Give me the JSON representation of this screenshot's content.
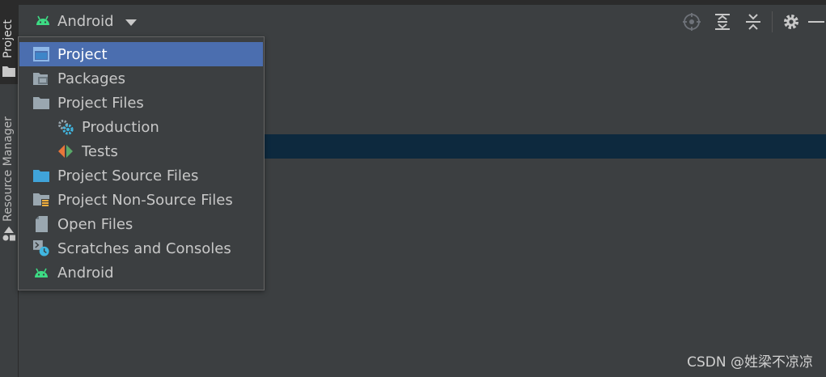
{
  "sidebar": {
    "tabs": [
      {
        "label": "Project",
        "icon": "folder-icon",
        "active": true
      },
      {
        "label": "Resource Manager",
        "icon": "shapes-icon",
        "active": false
      }
    ]
  },
  "header": {
    "view_selector": {
      "label": "Android",
      "icon": "android-icon"
    },
    "toolbar": [
      {
        "name": "locate-icon"
      },
      {
        "name": "expand-all-icon"
      },
      {
        "name": "collapse-all-icon"
      },
      {
        "name": "gear-icon"
      },
      {
        "name": "hide-icon"
      }
    ]
  },
  "dropdown": {
    "items": [
      {
        "label": "Project",
        "icon": "project-window-icon",
        "selected": true
      },
      {
        "label": "Packages",
        "icon": "packages-icon"
      },
      {
        "label": "Project Files",
        "icon": "folder-icon"
      },
      {
        "label": "Production",
        "icon": "production-gear-icon"
      },
      {
        "label": "Tests",
        "icon": "tests-icon"
      },
      {
        "label": "Project Source Files",
        "icon": "source-folder-icon"
      },
      {
        "label": "Project Non-Source Files",
        "icon": "non-source-folder-icon"
      },
      {
        "label": "Open Files",
        "icon": "file-icon"
      },
      {
        "label": "Scratches and Consoles",
        "icon": "scratches-icon"
      },
      {
        "label": "Android",
        "icon": "android-icon"
      }
    ]
  },
  "watermark": "CSDN @姓梁不凉凉",
  "colors": {
    "selection": "#4b6eaf",
    "android_green": "#3ddc84",
    "row_highlight": "#0d293e"
  }
}
